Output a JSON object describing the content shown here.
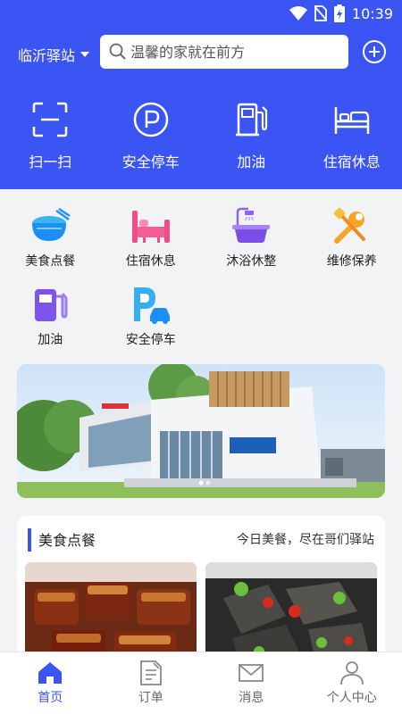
{
  "status_bar": {
    "time": "10:39"
  },
  "header": {
    "city": "临沂驿站",
    "search_placeholder": "温馨的家就在前方"
  },
  "quick_actions": [
    {
      "label": "扫一扫",
      "icon": "scan-icon"
    },
    {
      "label": "安全停车",
      "icon": "parking-icon"
    },
    {
      "label": "加油",
      "icon": "fuel-pump-icon"
    },
    {
      "label": "住宿休息",
      "icon": "bed-icon"
    }
  ],
  "services": [
    {
      "label": "美食点餐",
      "icon": "food-bowl-icon"
    },
    {
      "label": "住宿休息",
      "icon": "bed-icon"
    },
    {
      "label": "沐浴休整",
      "icon": "bathtub-icon"
    },
    {
      "label": "维修保养",
      "icon": "wrench-screwdriver-icon"
    },
    {
      "label": "加油",
      "icon": "fuel-pump-icon"
    },
    {
      "label": "安全停车",
      "icon": "parking-car-icon"
    }
  ],
  "food_section": {
    "title": "美食点餐",
    "subtitle": "今日美餐，尽在哥们驿站"
  },
  "tabbar": [
    {
      "label": "首页",
      "icon": "home-icon",
      "active": true
    },
    {
      "label": "订单",
      "icon": "order-icon",
      "active": false
    },
    {
      "label": "消息",
      "icon": "mail-icon",
      "active": false
    },
    {
      "label": "个人中心",
      "icon": "person-icon",
      "active": false
    }
  ],
  "colors": {
    "primary": "#3a55f3",
    "background": "#f2f3f5"
  }
}
